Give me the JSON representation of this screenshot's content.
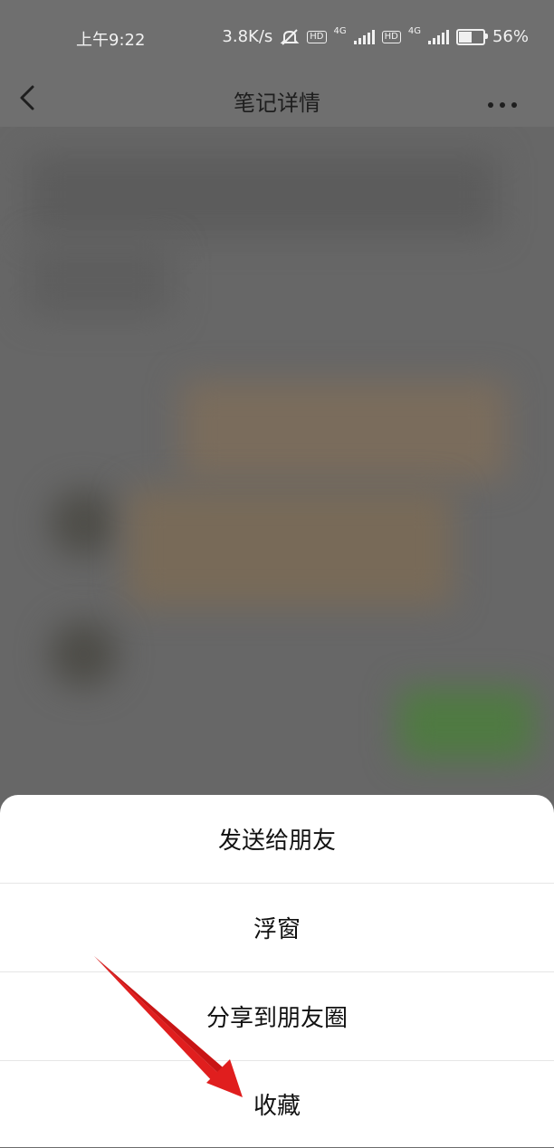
{
  "status_bar": {
    "time": "上午9:22",
    "speed": "3.8K/s",
    "hd1": "HD",
    "net1": "4G",
    "hd2": "HD",
    "net2": "4G",
    "battery": "56%"
  },
  "nav": {
    "back_icon": "chevron-left-icon",
    "title": "笔记详情",
    "more_icon": "more-horizontal-icon"
  },
  "sheet": {
    "items": [
      {
        "label": "发送给朋友"
      },
      {
        "label": "浮窗"
      },
      {
        "label": "分享到朋友圈"
      },
      {
        "label": "收藏"
      }
    ]
  },
  "colors": {
    "overlay": "#6b6b6b",
    "sheet": "#ffffff",
    "annotation": "#e01e1e"
  }
}
